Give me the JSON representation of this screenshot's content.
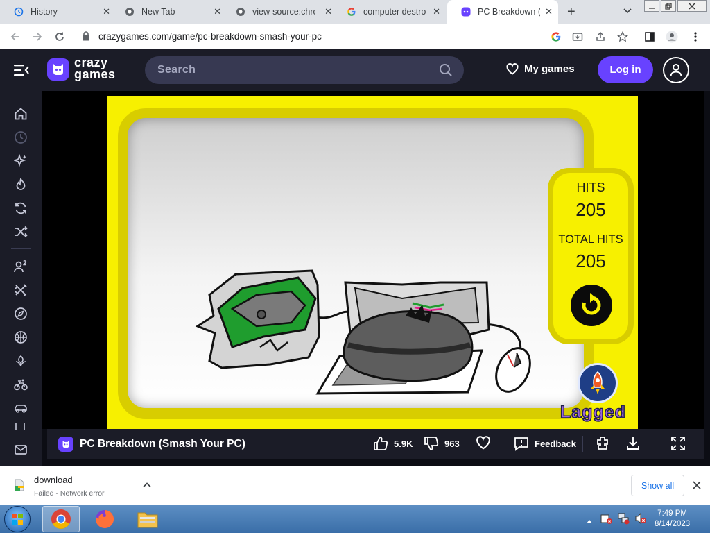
{
  "browser": {
    "tabs": [
      {
        "title": "History",
        "icon": "history-icon"
      },
      {
        "title": "New Tab",
        "icon": "chrome-icon"
      },
      {
        "title": "view-source:chrom",
        "icon": "chrome-icon"
      },
      {
        "title": "computer destroy",
        "icon": "google-icon"
      },
      {
        "title": "PC Breakdown (Sm",
        "icon": "crazygames-icon",
        "active": true
      }
    ],
    "url": "crazygames.com/game/pc-breakdown-smash-your-pc"
  },
  "site": {
    "logo_line1": "crazy",
    "logo_line2": "games",
    "search_placeholder": "Search",
    "my_games": "My games",
    "login": "Log in"
  },
  "game": {
    "hits_label": "HITS",
    "hits_value": "205",
    "total_label": "TOTAL HITS",
    "total_value": "205",
    "brand": "Lagged"
  },
  "gamebar": {
    "title": "PC Breakdown (Smash Your PC)",
    "likes": "5.9K",
    "dislikes": "963",
    "feedback": "Feedback"
  },
  "downloads": {
    "file_name": "download",
    "status": "Failed - Network error",
    "show_all": "Show all"
  },
  "taskbar": {
    "time": "7:49 PM",
    "date": "8/14/2023"
  },
  "colors": {
    "brand_purple": "#6842ff",
    "site_bg": "#1b1c27",
    "game_yellow": "#f7f000"
  }
}
